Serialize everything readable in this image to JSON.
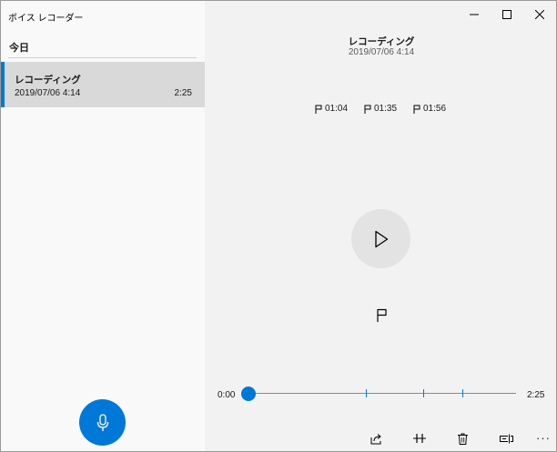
{
  "app": {
    "title": "ボイス レコーダー",
    "accent_color": "#0078d7"
  },
  "window_controls": [
    {
      "name": "minimize-icon"
    },
    {
      "name": "maximize-icon"
    },
    {
      "name": "close-icon"
    }
  ],
  "sidebar": {
    "group_label": "今日",
    "recordings": [
      {
        "name": "レコーディング",
        "date": "2019/07/06 4:14",
        "duration": "2:25",
        "selected": true
      }
    ],
    "record_button_icon": "microphone-icon"
  },
  "detail": {
    "title": "レコーディング",
    "date": "2019/07/06 4:14",
    "markers": [
      "01:04",
      "01:35",
      "01:56"
    ],
    "play_icon": "play-icon",
    "add_marker_icon": "flag-icon",
    "playback": {
      "current_time": "0:00",
      "total_time": "2:25",
      "progress": 0.0
    },
    "toolbar_icons": [
      "share-icon",
      "trim-icon",
      "delete-icon",
      "rename-icon",
      "more-icon"
    ],
    "more_label": "···"
  }
}
